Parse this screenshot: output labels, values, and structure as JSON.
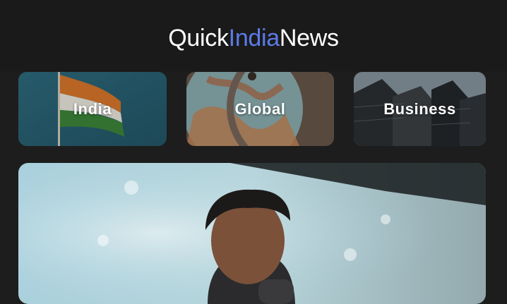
{
  "app": {
    "brand_part1": "Quick",
    "brand_part2": "India",
    "brand_part3": "News",
    "brand_color_primary": "#ffffff",
    "brand_color_accent": "#5b7be8"
  },
  "categories": [
    {
      "label": "India",
      "image": "indian-flag"
    },
    {
      "label": "Global",
      "image": "globe"
    },
    {
      "label": "Business",
      "image": "skyscrapers"
    }
  ],
  "featured": {
    "image": "speaker-at-event"
  }
}
